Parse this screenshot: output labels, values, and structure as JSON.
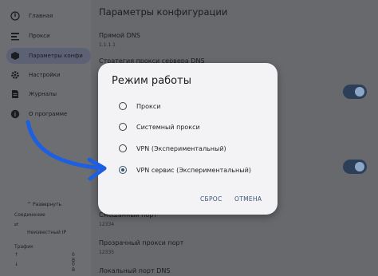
{
  "sidebar": {
    "items": [
      {
        "label": "Главная",
        "icon": "info-icon"
      },
      {
        "label": "Прокси",
        "icon": "proxy-icon"
      },
      {
        "label": "Параметры конфи",
        "icon": "box-icon"
      },
      {
        "label": "Настройки",
        "icon": "gear-icon"
      },
      {
        "label": "Журналы",
        "icon": "logs-icon"
      },
      {
        "label": "О программе",
        "icon": "info-icon"
      }
    ],
    "expand_label": "Развернуть",
    "connection_label": "Соединение",
    "connection_value": "Неизвестный IP",
    "traffic_label": "Трафик",
    "traffic_up": "0\nB",
    "traffic_down": "0\nB",
    "arrow_up": "↑",
    "arrow_down": "↓"
  },
  "main": {
    "title": "Параметры конфигурации",
    "settings": [
      {
        "title": "Прямой DNS",
        "value": "1.1.1.1"
      },
      {
        "title": "Смешанный порт",
        "value": "12334"
      },
      {
        "title": "Прозрачный прокси порт",
        "value": "12335"
      },
      {
        "title": "Локальный порт DNS",
        "value": ""
      }
    ],
    "partial_text": "Стратегия прокси сервера DNS"
  },
  "dialog": {
    "title": "Режим работы",
    "options": [
      {
        "label": "Прокси",
        "checked": false
      },
      {
        "label": "Системный прокси",
        "checked": false
      },
      {
        "label": "VPN (Экспериментальный)",
        "checked": false
      },
      {
        "label": "VPN сервис (Экспериментальный)",
        "checked": true
      }
    ],
    "reset_label": "СБРОС",
    "cancel_label": "ОТМЕНА"
  },
  "colors": {
    "accent": "#38526f",
    "annotation_arrow": "#1d5fe0",
    "scrim": "#6b6c70"
  }
}
